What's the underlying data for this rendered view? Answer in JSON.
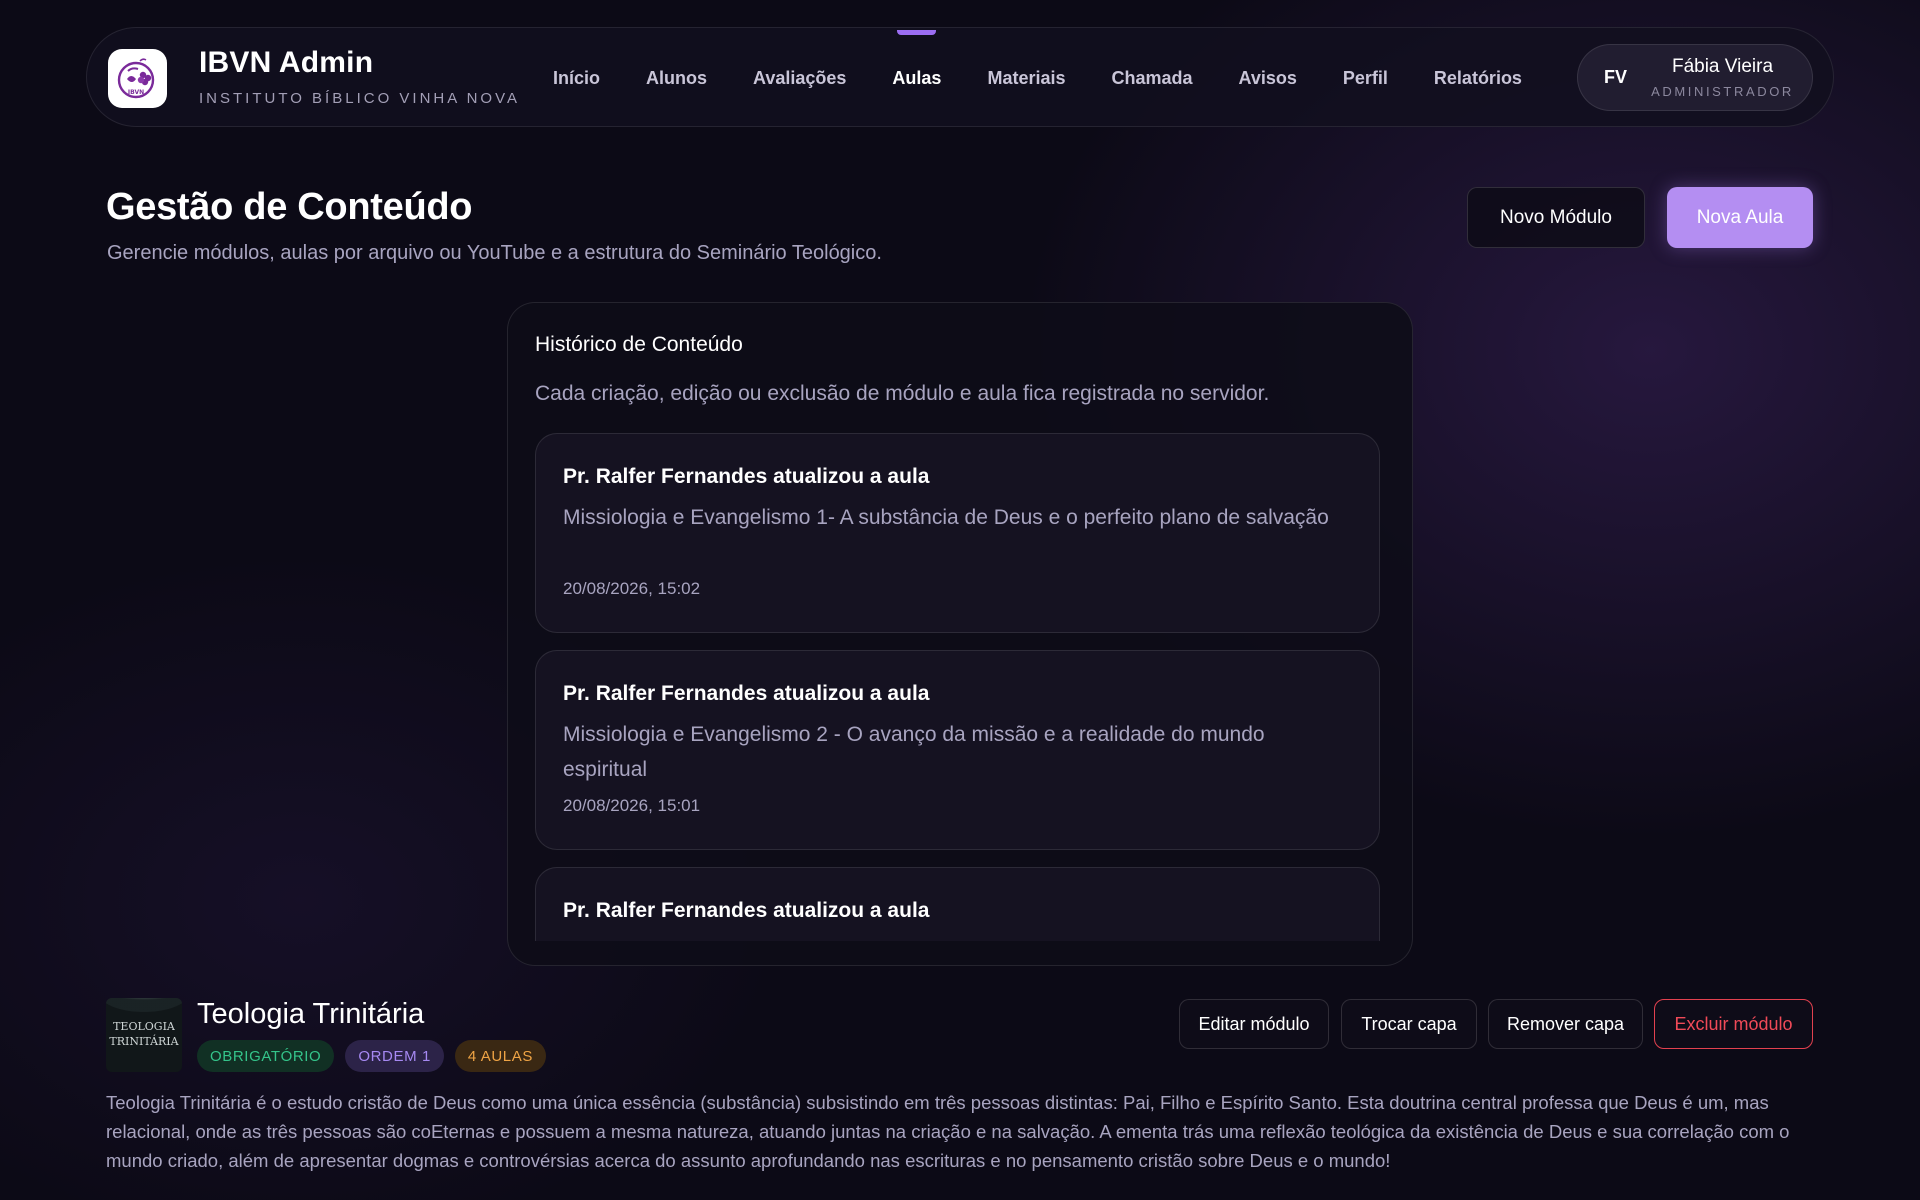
{
  "brand": {
    "title": "IBVN Admin",
    "subtitle": "INSTITUTO BÍBLICO VINHA NOVA",
    "logo_text": "IBVN"
  },
  "nav": {
    "items": [
      {
        "label": "Início",
        "active": false
      },
      {
        "label": "Alunos",
        "active": false
      },
      {
        "label": "Avaliações",
        "active": false
      },
      {
        "label": "Aulas",
        "active": true
      },
      {
        "label": "Materiais",
        "active": false
      },
      {
        "label": "Chamada",
        "active": false
      },
      {
        "label": "Avisos",
        "active": false
      },
      {
        "label": "Perfil",
        "active": false
      },
      {
        "label": "Relatórios",
        "active": false
      }
    ]
  },
  "user": {
    "initials": "FV",
    "name": "Fábia Vieira",
    "role": "ADMINISTRADOR"
  },
  "page": {
    "title": "Gestão de Conteúdo",
    "subtitle": "Gerencie módulos, aulas por arquivo ou YouTube e a estrutura do Seminário Teológico.",
    "btn_new_module": "Novo Módulo",
    "btn_new_lesson": "Nova Aula"
  },
  "history": {
    "title": "Histórico de Conteúdo",
    "description": "Cada criação, edição ou exclusão de módulo e aula fica registrada no servidor.",
    "entries": [
      {
        "title": "Pr. Ralfer Fernandes atualizou a aula",
        "lesson": "Missiologia e Evangelismo 1- A substância de Deus e o perfeito plano de salvação",
        "date": "20/08/2026, 15:02"
      },
      {
        "title": "Pr. Ralfer Fernandes atualizou a aula",
        "lesson": "Missiologia e Evangelismo 2 - O avanço da missão e a realidade do mundo espiritual",
        "date": "20/08/2026, 15:01"
      },
      {
        "title": "Pr. Ralfer Fernandes atualizou a aula",
        "lesson": "",
        "date": ""
      }
    ]
  },
  "module": {
    "title": "Teologia Trinitária",
    "cover_text_1": "TEOLOGIA",
    "cover_text_2": "TRINITÁRIA",
    "badges": {
      "required": "OBRIGATÓRIO",
      "order": "ORDEM 1",
      "lessons": "4 AULAS"
    },
    "actions": {
      "edit": "Editar módulo",
      "change_cover": "Trocar capa",
      "remove_cover": "Remover capa",
      "delete": "Excluir módulo"
    },
    "description": "Teologia Trinitária é o estudo cristão de Deus como uma única essência (substância) subsistindo em três pessoas distintas: Pai, Filho e Espírito Santo. Esta doutrina central professa que Deus é um, mas relacional, onde as três pessoas são coEternas e possuem a mesma natureza, atuando juntas na criação e na salvação. A ementa trás uma reflexão teológica da existência de Deus e sua correlação com o mundo criado, além de apresentar dogmas e controvérsias acerca do assunto aprofundando nas escrituras e no pensamento cristão sobre Deus e o mundo!"
  },
  "colors": {
    "accent": "#9b6df2",
    "primary_button": "#b48ef2",
    "danger": "#e2414f",
    "badge_green": "#34c48a",
    "badge_purple": "#a689f2",
    "badge_orange": "#efa445"
  }
}
